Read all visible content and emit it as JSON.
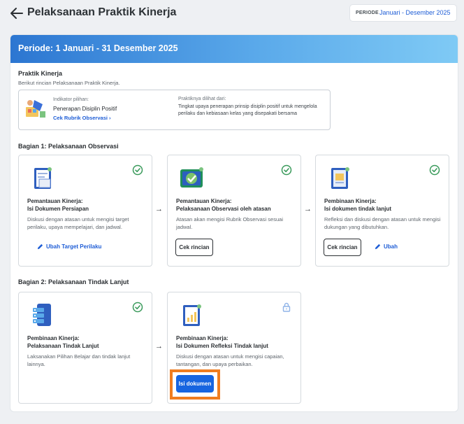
{
  "header": {
    "back_icon": "arrow-left-icon",
    "title": "Pelaksanaan Praktik Kinerja",
    "period_label": "PERIODE",
    "period_value": "Januari - Desember 2025"
  },
  "banner": {
    "title": "Periode: 1 Januari - 31 Desember 2025"
  },
  "praktik": {
    "title": "Praktik Kinerja",
    "subtitle": "Berikut rincian Pelaksanaan Praktik Kinerja.",
    "indicator_caption": "Indikator pilihan:",
    "indicator_name": "Penerapan Disiplin Positif",
    "rubric_link": "Cek Rubrik Observasi",
    "seen_caption": "Praktiknya dilihat dari:",
    "seen_desc": "Tingkat upaya penerapan prinsip disiplin positif untuk mengelola perilaku dan kebiasaan kelas yang disepakati bersama"
  },
  "part1": {
    "title": "Bagian 1: Pelaksanaan Observasi",
    "tiles": [
      {
        "title1": "Pemantauan Kinerja:",
        "title2": "Isi Dokumen Persiapan",
        "desc": "Diskusi dengan atasan untuk mengisi target perilaku, upaya mempelajari, dan jadwal.",
        "link": "Ubah Target Perilaku",
        "status": "check-circle-icon"
      },
      {
        "title1": "Pemantauan Kinerja:",
        "title2": "Pelaksanaan Observasi oleh atasan",
        "desc": "Atasan akan mengisi Rubrik Observasi sesuai jadwal.",
        "button": "Cek rincian",
        "status": "check-circle-icon"
      },
      {
        "title1": "Pembinaan Kinerja:",
        "title2": "Isi dokumen tindak lanjut",
        "desc": "Refleksi dan diskusi dengan atasan untuk mengisi dukungan yang dibutuhkan.",
        "button": "Cek rincian",
        "link": "Ubah",
        "status": "check-circle-icon"
      }
    ]
  },
  "part2": {
    "title": "Bagian 2: Pelaksanaan Tindak Lanjut",
    "tiles": [
      {
        "title1": "Pembinaan Kinerja:",
        "title2": "Pelaksanaan Tindak Lanjut",
        "desc": "Laksanakan Pilihan Belajar dan tindak lanjut lainnya.",
        "status": "check-circle-icon"
      },
      {
        "title1": "Pembinaan Kinerja:",
        "title2": "Isi Dokumen Refleksi Tindak lanjut",
        "desc": "Diskusi dengan atasan untuk mengisi capaian, tantangan, dan upaya perbaikan.",
        "button": "Isi dokumen",
        "status": "lock-icon"
      }
    ]
  },
  "colors": {
    "accent": "#1765e0",
    "success": "#3a9a5b",
    "highlight": "#f07d1f"
  }
}
